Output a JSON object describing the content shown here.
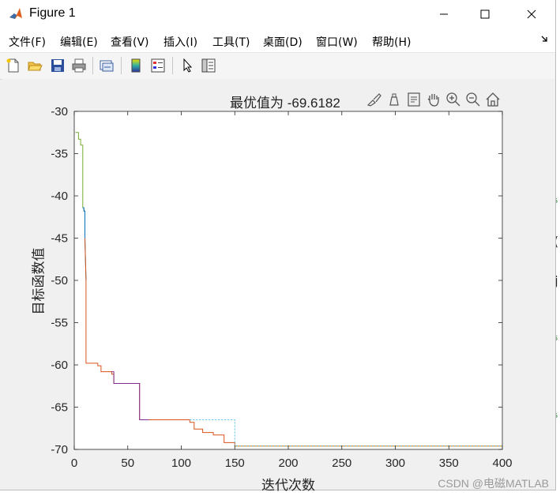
{
  "window": {
    "title": "Figure 1",
    "app_icon": "matlab-icon",
    "controls": [
      "minimize-icon",
      "maximize-icon",
      "close-icon"
    ]
  },
  "menubar": {
    "items": [
      "文件(F)",
      "编辑(E)",
      "查看(V)",
      "插入(I)",
      "工具(T)",
      "桌面(D)",
      "窗口(W)",
      "帮助(H)"
    ],
    "overflow_icon": "menu-overflow-arrow-icon"
  },
  "toolbar": {
    "buttons": [
      "new-figure-icon",
      "open-icon",
      "save-icon",
      "print-icon",
      "link-plot-icon",
      "insert-colorbar-icon",
      "insert-legend-icon",
      "edit-plot-arrow-icon",
      "property-inspector-icon"
    ]
  },
  "axes_toolbar": {
    "buttons": [
      "brush-icon",
      "data-tips-icon",
      "rotate-icon",
      "pan-icon",
      "zoom-in-icon",
      "zoom-out-icon",
      "home-icon"
    ]
  },
  "background": {
    "fragments": [
      "%",
      "(",
      "j",
      "%",
      "%"
    ]
  },
  "chart_data": {
    "type": "line",
    "title": "最优值为 -69.6182",
    "xlabel": "迭代次数",
    "ylabel": "目标函数值",
    "xlim": [
      0,
      400
    ],
    "ylim": [
      -70,
      -30
    ],
    "xticks": [
      0,
      50,
      100,
      150,
      200,
      250,
      300,
      350,
      400
    ],
    "yticks": [
      -30,
      -35,
      -40,
      -45,
      -50,
      -55,
      -60,
      -65,
      -70
    ],
    "grid": false,
    "colors": {
      "series1": "#77ac30",
      "series2": "#0072bd",
      "series3": "#d95319",
      "series4": "#7e2f8e",
      "series5": "#edb120",
      "series6": "#4dbeee"
    },
    "series": [
      {
        "x": [
          1,
          4,
          4,
          6,
          6,
          8,
          8,
          9,
          9,
          10
        ],
        "y": [
          -32.5,
          -32.5,
          -33.3,
          -33.3,
          -34,
          -34,
          -41.4,
          -41.4,
          -41.8,
          -41.8
        ]
      },
      {
        "x": [
          8,
          9,
          9,
          10,
          10,
          11
        ],
        "y": [
          -41.4,
          -41.4,
          -41.8,
          -41.8,
          -45,
          -50
        ]
      },
      {
        "x": [
          10,
          11,
          11,
          22,
          22,
          25,
          25,
          35,
          35,
          37,
          37,
          61,
          61,
          108,
          108,
          112,
          112,
          120,
          120,
          130,
          130,
          140,
          140,
          150,
          150,
          400
        ],
        "y": [
          -45,
          -50,
          -59.8,
          -59.8,
          -60.1,
          -60.1,
          -60.8,
          -60.8,
          -61.1,
          -61.1,
          -62.2,
          -62.2,
          -66.5,
          -66.5,
          -66.8,
          -66.8,
          -67.6,
          -67.6,
          -68,
          -68,
          -68.3,
          -68.3,
          -69.2,
          -69.2,
          -69.6,
          -69.6
        ]
      },
      {
        "x": [
          35,
          37,
          37,
          61,
          61,
          70
        ],
        "y": [
          -60.8,
          -60.8,
          -62.2,
          -62.2,
          -66.5,
          -66.5
        ]
      },
      {
        "x": [
          150,
          400
        ],
        "y": [
          -69.6,
          -69.6
        ]
      },
      {
        "x": [
          108,
          150,
          150,
          400
        ],
        "y": [
          -66.5,
          -66.5,
          -69.6,
          -69.6
        ]
      }
    ]
  },
  "watermark": "CSDN @电磁MATLAB"
}
